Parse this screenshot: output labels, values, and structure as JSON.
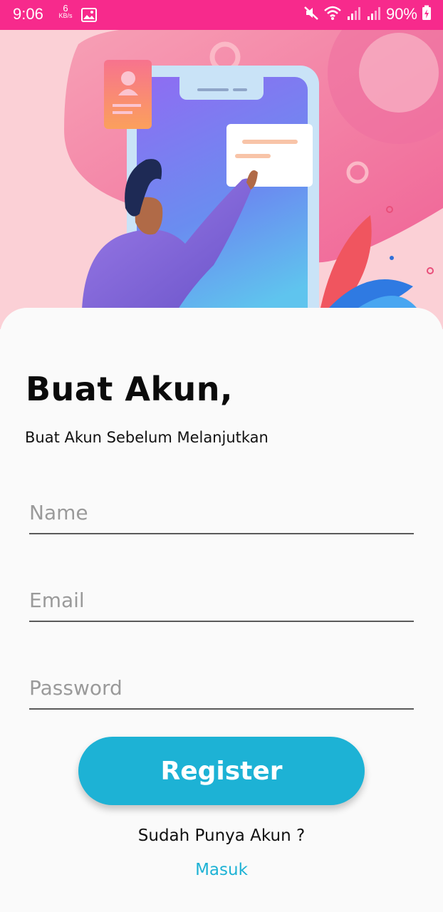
{
  "status_bar": {
    "time": "9:06",
    "speed_value": "6",
    "speed_unit": "KB/s",
    "battery": "90%",
    "icons": [
      "gallery-icon",
      "mute-icon",
      "wifi-icon",
      "signal-icon",
      "signal-icon-2",
      "battery-charging-icon"
    ]
  },
  "colors": {
    "status_bar": "#f72a8c",
    "accent": "#1db2d5",
    "hero_background": "#fbd0d6"
  },
  "form": {
    "title": "Buat Akun,",
    "subtitle": "Buat Akun Sebelum Melanjutkan",
    "name_placeholder": "Name",
    "email_placeholder": "Email",
    "password_placeholder": "Password",
    "register_label": "Register"
  },
  "footer": {
    "have_account": "Sudah Punya Akun ?",
    "login_link": "Masuk"
  }
}
